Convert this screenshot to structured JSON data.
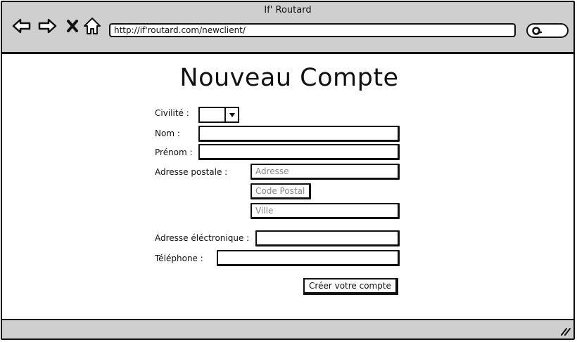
{
  "window": {
    "title": "If' Routard"
  },
  "browser": {
    "url": "http://if'routard.com/newclient/",
    "icons": [
      "back-arrow-icon",
      "forward-arrow-icon",
      "close-x-icon",
      "home-icon",
      "search-icon",
      "resize-grip-icon"
    ]
  },
  "page": {
    "heading": "Nouveau Compte",
    "form": {
      "civilite_label": "Civilité :",
      "nom_label": "Nom :",
      "prenom_label": "Prénom :",
      "adresse_label": "Adresse postale :",
      "adresse_placeholder": "Adresse",
      "code_postal_placeholder": "Code Postal",
      "ville_placeholder": "Ville",
      "email_label": "Adresse éléctronique :",
      "telephone_label": "Téléphone :",
      "submit_label": "Créer votre compte"
    }
  }
}
